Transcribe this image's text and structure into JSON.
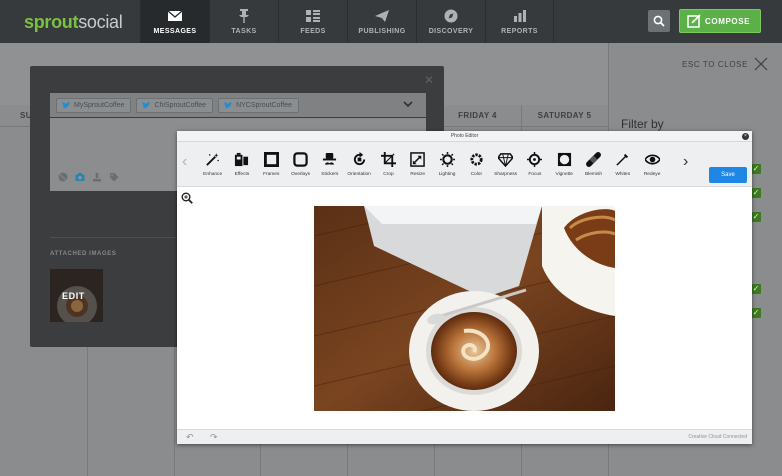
{
  "brand": {
    "part1": "sprout",
    "part2": "social"
  },
  "nav": [
    {
      "label": "MESSAGES",
      "icon": "envelope-icon",
      "active": true
    },
    {
      "label": "TASKS",
      "icon": "pin-icon",
      "active": false
    },
    {
      "label": "FEEDS",
      "icon": "feeds-icon",
      "active": false
    },
    {
      "label": "PUBLISHING",
      "icon": "paper-plane-icon",
      "active": false
    },
    {
      "label": "DISCOVERY",
      "icon": "compass-icon",
      "active": false
    },
    {
      "label": "REPORTS",
      "icon": "bar-chart-icon",
      "active": false
    }
  ],
  "compose_label": "COMPOSE",
  "calendar": {
    "days": [
      "SU",
      "FRIDAY 4",
      "SATURDAY 5"
    ],
    "esc_label": "ESC TO CLOSE",
    "filter_label": "Filter by"
  },
  "compose": {
    "profiles": [
      "MySproutCoffee",
      "ChiSproutCoffee",
      "NYCSproutCoffee"
    ],
    "attached_label": "ATTACHED IMAGES",
    "edit_label": "EDIT"
  },
  "editor": {
    "title": "Photo Editor",
    "tools": [
      {
        "label": "Enhance",
        "icon": "magic-wand-icon"
      },
      {
        "label": "Effects",
        "icon": "effects-icon"
      },
      {
        "label": "Frames",
        "icon": "frame-icon"
      },
      {
        "label": "Overlays",
        "icon": "overlay-icon"
      },
      {
        "label": "Stickers",
        "icon": "hat-mustache-icon"
      },
      {
        "label": "Orientation",
        "icon": "rotate-icon"
      },
      {
        "label": "Crop",
        "icon": "crop-icon"
      },
      {
        "label": "Resize",
        "icon": "resize-icon"
      },
      {
        "label": "Lighting",
        "icon": "sun-icon"
      },
      {
        "label": "Color",
        "icon": "color-icon"
      },
      {
        "label": "Sharpness",
        "icon": "diamond-icon"
      },
      {
        "label": "Focus",
        "icon": "focus-icon"
      },
      {
        "label": "Vignette",
        "icon": "vignette-icon"
      },
      {
        "label": "Blemish",
        "icon": "bandage-icon"
      },
      {
        "label": "Whiten",
        "icon": "brush-icon"
      },
      {
        "label": "Redeye",
        "icon": "eye-icon"
      }
    ],
    "save_label": "Save",
    "footer_note": "Creative Cloud Connected"
  },
  "colors": {
    "accent": "#5bb147",
    "save": "#1f86e6"
  }
}
